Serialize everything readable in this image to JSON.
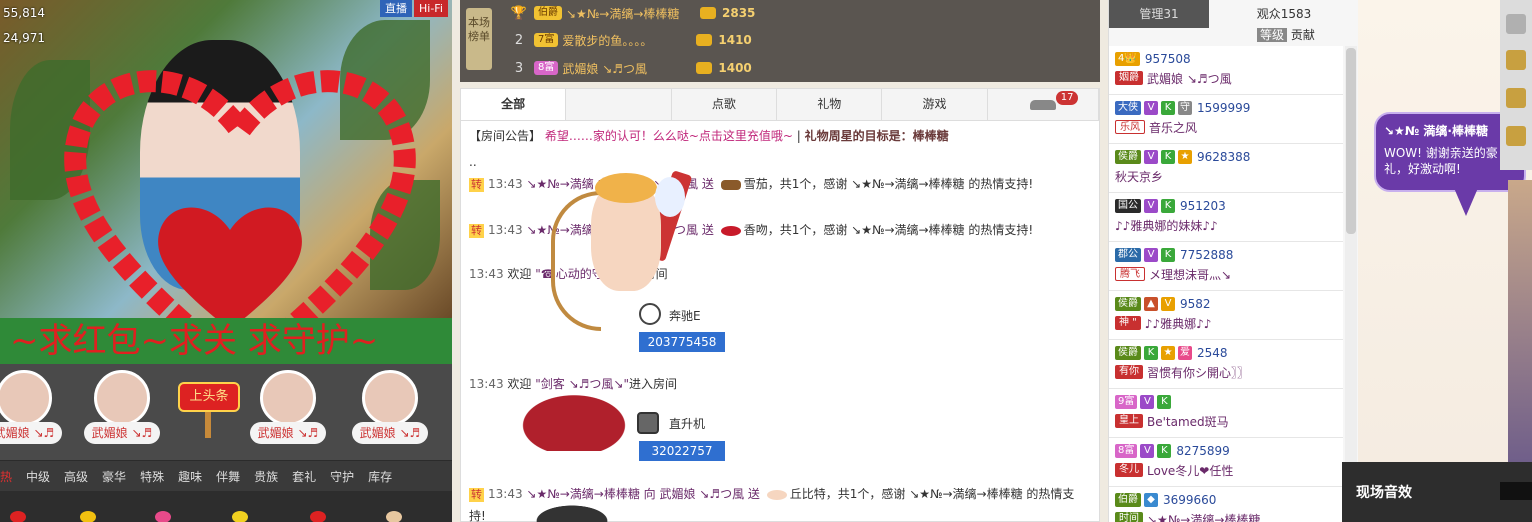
{
  "video": {
    "counter_top": "55,814",
    "counter_bottom": "24,971",
    "btn_live": "直播",
    "btn_hifi": "Hi-Fi",
    "banner_text": "~求红包~求关      求守护~",
    "fans": [
      "武媚娘 ↘♬",
      "武媚娘 ↘♬",
      "武媚娘 ↘♬",
      "武媚娘 ↘♬"
    ],
    "top_label": "上头条"
  },
  "gift_categories": [
    "热",
    "中级",
    "高级",
    "豪华",
    "特殊",
    "趣味",
    "伴舞",
    "贵族",
    "套礼",
    "守护",
    "库存"
  ],
  "ranking": {
    "title": "本场榜单",
    "rows": [
      {
        "rank": "",
        "badge": "伯爵",
        "name": "↘★№→満缡→棒棒糖",
        "score": "2835"
      },
      {
        "rank": "2",
        "badge": "7富",
        "name": "爱散步的鱼。。。。",
        "score": "1410"
      },
      {
        "rank": "3",
        "badge": "8富",
        "name": "武媚娘 ↘♬つ風",
        "score": "1400"
      }
    ]
  },
  "tabs": {
    "all": "全部",
    "song": "点歌",
    "gift": "礼物",
    "game": "游戏",
    "car_badge": "17"
  },
  "notice": {
    "prefix": "【房间公告】",
    "body": "希望……家的认可！么么哒~点击这里充值哦~",
    "sep": "|",
    "target": "礼物周星的目标是：棒棒糖"
  },
  "messages": {
    "dots": "..",
    "m1_tag": "转",
    "m1_time": "13:43",
    "m1_from": "↘★№→満缡",
    "m1_mid": "向 武媚娘 ↘♬つ風 送",
    "m1_rest": "雪茄，共1个，感谢 ↘★№→満缡→棒棒糖 的热情支持!",
    "m2_tag": "转",
    "m2_time": "13:43",
    "m2_from": "↘★№→満缡",
    "m2_mid": "向 武媚娘 ↘♬つ風 送",
    "m2_rest": "香吻，共1个，感谢 ↘★№→満缡→棒棒糖 的热情支持!",
    "w1_time": "13:43",
    "w1_text": "欢迎",
    "w1_who": "\"☎心动的守候",
    "w1_end": "进入房间",
    "car_name": "奔驰E",
    "car_id": "203775458",
    "w2_time": "13:43",
    "w2_text": "欢迎",
    "w2_who": "\"剑客 ↘♬つ風↘\"",
    "w2_end": "进入房间",
    "heli_name": "直升机",
    "heli_id": "32022757",
    "m3_tag": "转",
    "m3_time": "13:43",
    "m3_from": "↘★№→満缡→棒棒糖",
    "m3_mid": "向 武媚娘 ↘♬つ風 送",
    "m3_rest": "丘比特，共1个，感谢 ↘★№→満缡→棒棒糖 的热情支持!"
  },
  "audience": {
    "tab_admin": "管理31",
    "tab_audience": "观众1583",
    "sub_level": "等级",
    "sub_contrib": "贡献",
    "users": [
      {
        "lv": "4👑",
        "id": "957508",
        "plate": "姻爵",
        "name": "武媚娘 ↘♬つ風"
      },
      {
        "lv": "大侠",
        "id": "1599999",
        "plate": "乐风",
        "name": "音乐之风"
      },
      {
        "lv": "侯爵",
        "id": "9628388",
        "plate": "",
        "name": "秋天京乡"
      },
      {
        "lv": "国公",
        "id": "951203",
        "plate": "",
        "name": "♪♪雅典娜的妹妹♪♪"
      },
      {
        "lv": "郡公",
        "id": "7752888",
        "plate": "腾飞",
        "name": "メ理想沫哥灬↘"
      },
      {
        "lv": "侯爵",
        "id": "9582",
        "plate": "神 \"",
        "name": "♪♪雅典娜♪♪"
      },
      {
        "lv": "侯爵",
        "id": "2548",
        "plate": "有你",
        "name": "習惯有你シ開心〗〗"
      },
      {
        "lv": "9富",
        "id": "",
        "plate": "皇上",
        "name": "Be'tamed斑马"
      },
      {
        "lv": "8富",
        "id": "8275899",
        "plate": "冬儿",
        "name": "Love冬儿❤任性"
      },
      {
        "lv": "伯爵",
        "id": "3699660",
        "plate": "时间",
        "name": "↘★№→満缡→棒棒糖"
      }
    ]
  },
  "far": {
    "bubble_title": "↘★№ 満缡·棒棒糖",
    "bubble_text": "WOW! 谢谢亲送的豪礼，好激动啊!",
    "fx_label": "现场音效"
  }
}
